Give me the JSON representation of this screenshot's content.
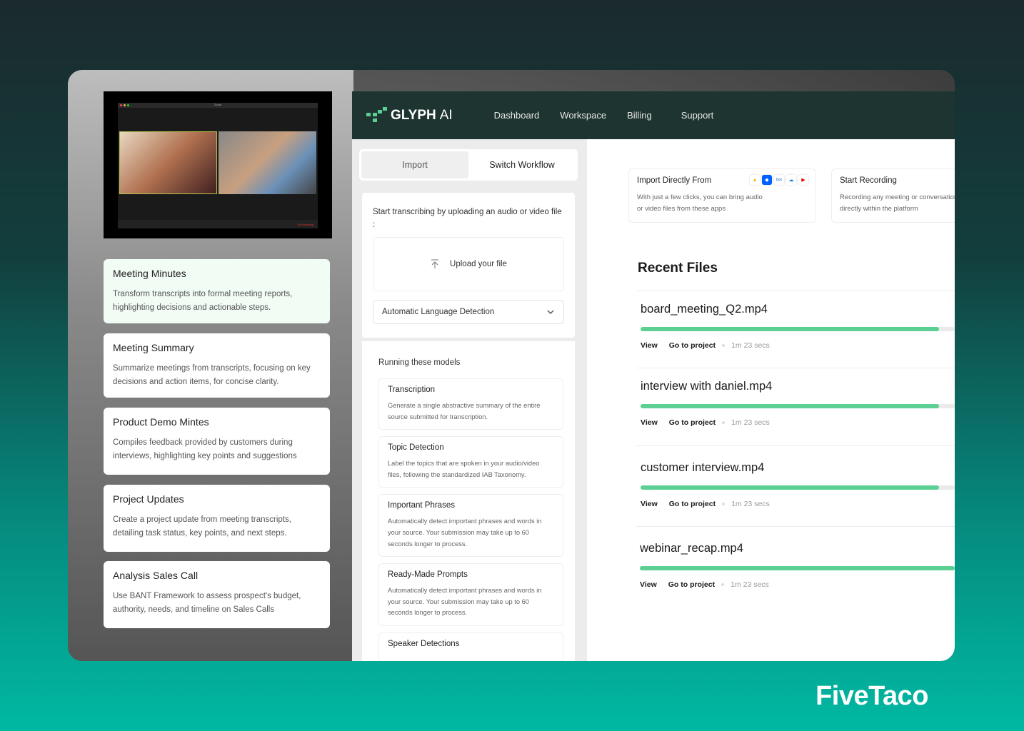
{
  "zoom_call": {
    "title": "Zoom",
    "end_label": "End Meeting"
  },
  "templates": [
    {
      "title": "Meeting Minutes",
      "desc": "Transform transcripts into formal meeting reports, highlighting decisions and actionable steps."
    },
    {
      "title": "Meeting Summary",
      "desc": "Summarize meetings from transcripts, focusing on key decisions and action items, for concise clarity."
    },
    {
      "title": "Product Demo Mintes",
      "desc": "Compiles feedback provided by customers during interviews, highlighting key points and suggestions"
    },
    {
      "title": "Project Updates",
      "desc": "Create a project update from meeting transcripts, detailing task status, key points, and next steps."
    },
    {
      "title": "Analysis Sales Call",
      "desc": "Use BANT Framework to assess prospect's budget, authority, needs, and timeline on Sales Calls"
    }
  ],
  "header": {
    "logo": "GLYPH",
    "logo_suffix": "AI",
    "nav": [
      "Dashboard",
      "Workspace",
      "Billing",
      "Support"
    ]
  },
  "tabs": {
    "import": "Import",
    "switch": "Switch Workflow"
  },
  "upload": {
    "intro": "Start transcribing by uploading an audio or  video file :",
    "button": "Upload your file",
    "language": "Automatic Language Detection"
  },
  "models": {
    "title": "Running these models",
    "items": [
      {
        "title": "Transcription",
        "desc": "Generate a single abstractive summary of the entire source submitted for transcription."
      },
      {
        "title": "Topic Detection",
        "desc": "Label the topics that are spoken in your audio/video files, following the standardized IAB Taxonomy."
      },
      {
        "title": "Important Phrases",
        "desc": "Automatically detect important phrases and words in your source. Your submission may take up to 60 seconds longer to process."
      },
      {
        "title": "Ready-Made Prompts",
        "desc": "Automatically detect important phrases and words in your source. Your submission may take up to 60 seconds longer to process."
      },
      {
        "title": "Speaker Detections",
        "desc": ""
      }
    ]
  },
  "import_card": {
    "title": "Import Directly From",
    "desc1": "With just a few clicks, you can bring audio",
    "desc2": "or video files from these apps",
    "apps": [
      "google-drive-icon",
      "dropbox-icon",
      "box-icon",
      "onedrive-icon",
      "youtube-icon"
    ],
    "box_label": "box"
  },
  "record_card": {
    "title": "Start Recording",
    "desc1": "Recording any meeting or conversation",
    "desc2": "directly within the platform"
  },
  "recent": {
    "title": "Recent Files",
    "files": [
      {
        "name": "board_meeting_Q2.mp4",
        "progress": 95,
        "view": "View",
        "go": "Go to project",
        "duration": "1m 23 secs"
      },
      {
        "name": "interview with daniel.mp4",
        "progress": 95,
        "view": "View",
        "go": "Go to project",
        "duration": "1m 23 secs"
      },
      {
        "name": "customer interview.mp4",
        "progress": 95,
        "view": "View",
        "go": "Go to project",
        "duration": "1m 23 secs"
      },
      {
        "name": "webinar_recap.mp4",
        "progress": 100,
        "view": "View",
        "go": "Go to project",
        "duration": "1m 23 secs"
      }
    ]
  },
  "brand": "FiveTaco",
  "colors": {
    "header": "#1d3430",
    "accent": "#5ccf93",
    "background_bottom": "#00b9a3"
  }
}
